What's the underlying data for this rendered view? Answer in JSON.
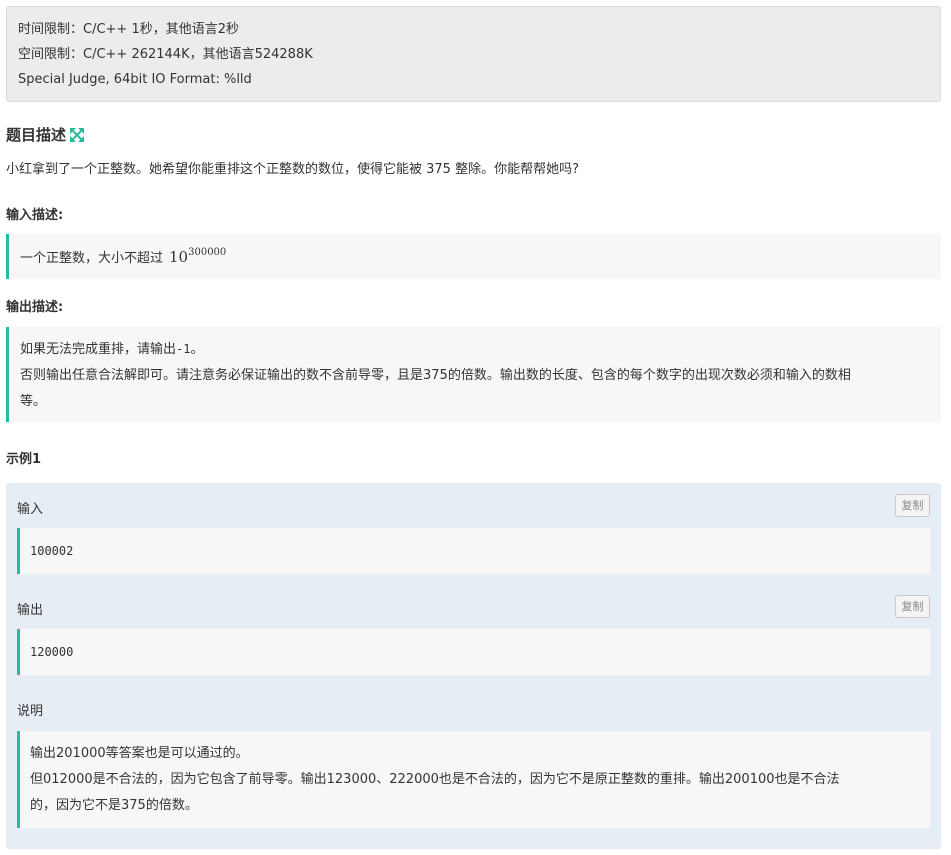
{
  "limits": {
    "time": "时间限制：C/C++ 1秒，其他语言2秒",
    "space": "空间限制：C/C++ 262144K，其他语言524288K",
    "judge": "Special Judge, 64bit IO Format: %lld"
  },
  "problem": {
    "title": "题目描述",
    "description": "小红拿到了一个正整数。她希望你能重排这个正整数的数位，使得它能被 375 整除。你能帮帮她吗?"
  },
  "input_section": {
    "heading": "输入描述:",
    "text": "一个正整数，大小不超过",
    "math_base": "10",
    "math_exp": "300000"
  },
  "output_section": {
    "heading": "输出描述:",
    "line1_prefix": "如果无法完成重排，请输出",
    "line1_code": "-1",
    "line1_suffix": "。",
    "line2": "否则输出任意合法解即可。请注意务必保证输出的数不含前导零，且是375的倍数。输出数的长度、包含的每个数字的出现次数必须和输入的数相",
    "line3": "等。"
  },
  "example": {
    "heading": "示例1",
    "input_label": "输入",
    "input_value": "100002",
    "output_label": "输出",
    "output_value": "120000",
    "copy_label": "复制",
    "explain_label": "说明",
    "explain_line1": "输出201000等答案也是可以通过的。",
    "explain_line2": "但012000是不合法的，因为它包含了前导零。输出123000、222000也是不合法的，因为它不是原正整数的重排。输出200100也是不合法",
    "explain_line3": "的，因为它不是375的倍数。"
  },
  "colors": {
    "accent": "#25bb9b",
    "example_bg": "#e6edf4",
    "limits_bg": "#ececec"
  },
  "icons": {
    "expand": "expand-arrows-icon"
  }
}
